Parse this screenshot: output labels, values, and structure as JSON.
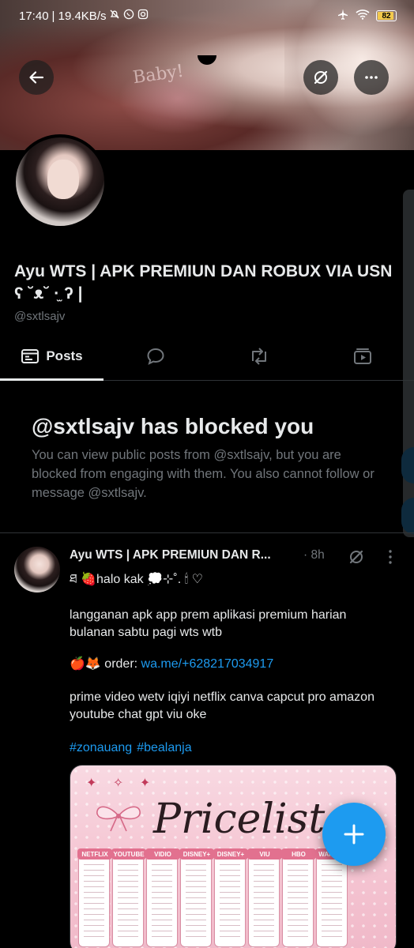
{
  "status_bar": {
    "time": "17:40",
    "speed": "| 19.4KB/s",
    "battery": "82"
  },
  "banner": {
    "text": "Baby!"
  },
  "profile": {
    "name": "Ayu WTS | APK PREMIUN DAN ROBUX VIA USN ʕ ˘ᴥ˘ ·̫ ʔ |",
    "handle": "@sxtlsajv"
  },
  "tabs": [
    {
      "label": "Posts",
      "icon": "posts-icon",
      "active": true
    },
    {
      "label": "",
      "icon": "reply-icon",
      "active": false
    },
    {
      "label": "",
      "icon": "repost-icon",
      "active": false
    },
    {
      "label": "",
      "icon": "media-icon",
      "active": false
    }
  ],
  "blocked": {
    "title": "@sxtlsajv has blocked you",
    "description": "You can view public posts from @sxtlsajv, but you are blocked from engaging with them. You also cannot follow or message @sxtlsajv."
  },
  "post": {
    "author": "Ayu WTS | APK PREMIUN DAN R...",
    "time": "· 8h",
    "line1": "ཐ 🍓halo kak 💭⊹˚. 🕯 ♡",
    "line2": "langganan apk app prem aplikasi premium harian bulanan sabtu pagi wts wtb",
    "order_prefix": "🍎🦊 order: ",
    "order_link": "wa.me/+628217034917",
    "line4": "prime video wetv iqiyi netflix canva capcut pro amazon youtube chat gpt viu oke",
    "hashtags": [
      "#zonauang",
      "#bealanja"
    ],
    "media": {
      "title": "Pricelist",
      "columns": [
        "NETFLIX",
        "YOUTUBE",
        "VIDIO",
        "DISNEY+",
        "DISNEY+",
        "VIU",
        "HBO",
        "WARNER"
      ]
    }
  },
  "colors": {
    "accent": "#1d9bf0",
    "muted": "#71767b",
    "text": "#e7e9ea",
    "background": "#000000"
  }
}
